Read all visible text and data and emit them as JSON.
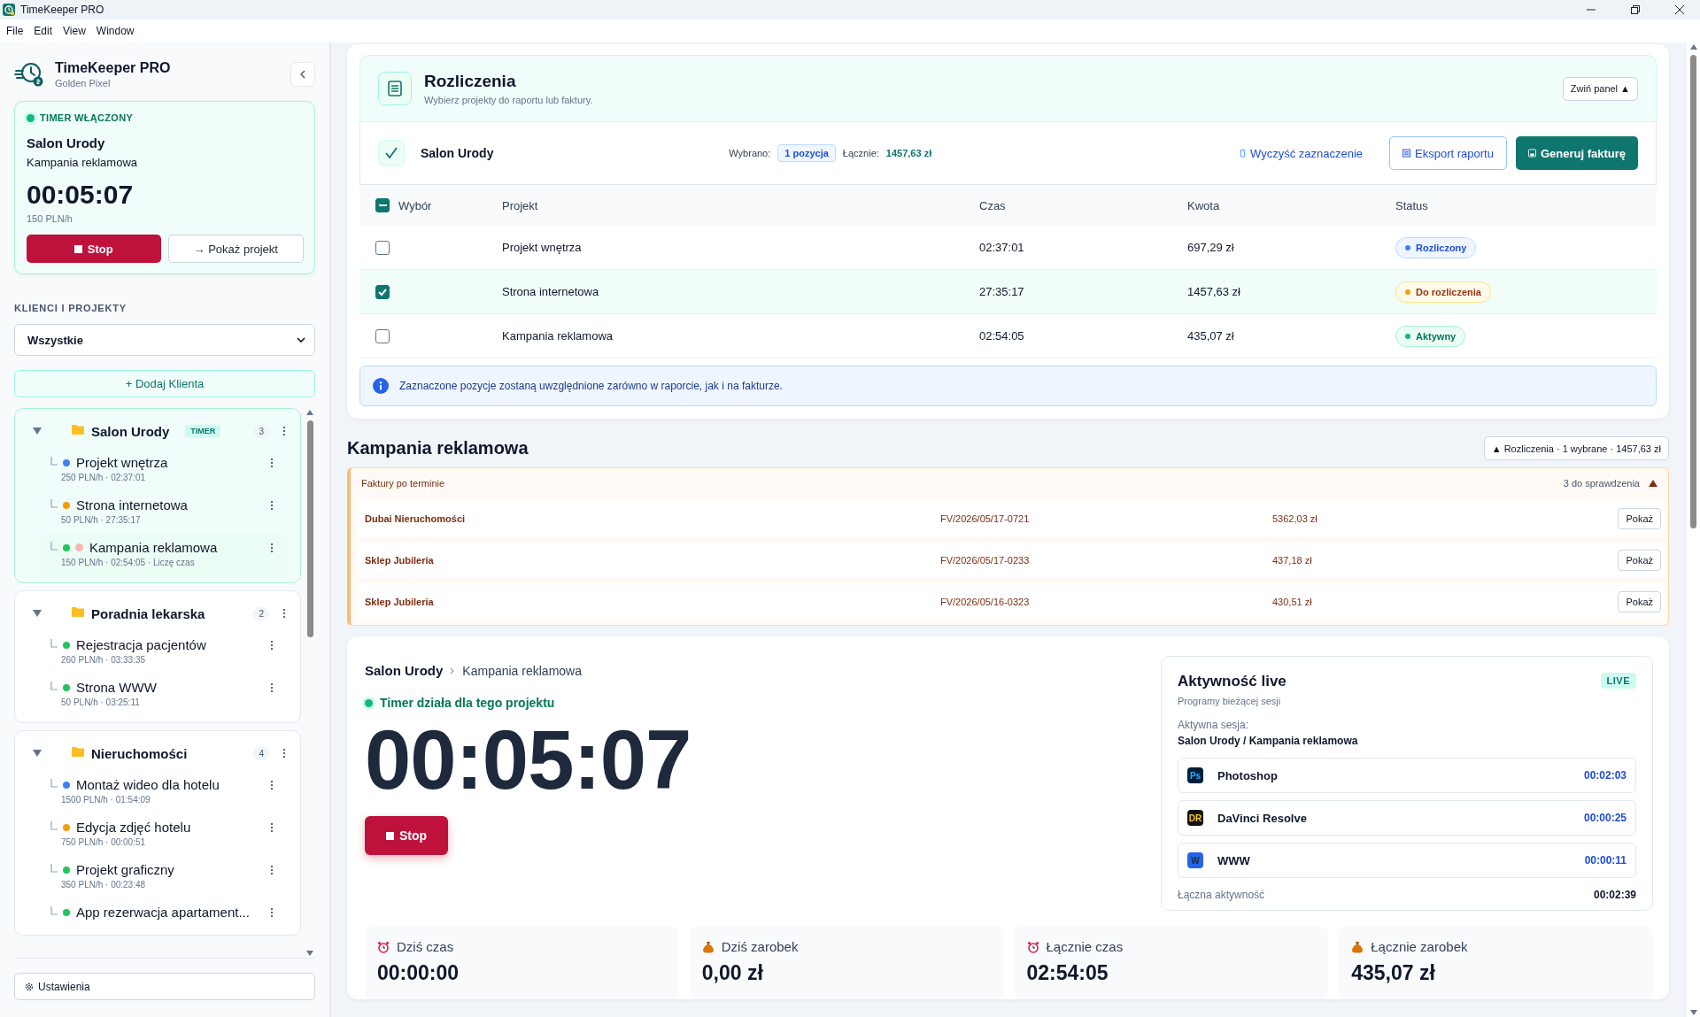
{
  "window": {
    "title": "TimeKeeper PRO"
  },
  "menu": [
    "File",
    "Edit",
    "View",
    "Window"
  ],
  "sidebar": {
    "app_name": "TimeKeeper PRO",
    "subtitle": "Golden Pixel",
    "timer_card": {
      "status": "TIMER WŁĄCZONY",
      "running": true,
      "client": "Salon Urody",
      "project": "Kampania reklamowa",
      "time": "00:05:07",
      "rate": "150 PLN/h",
      "stop": "Stop",
      "show": "→ Pokaż projekt"
    },
    "section_title": "KLIENCI I PROJEKTY",
    "filter": {
      "value": "Wszystkie"
    },
    "add_button": "+ Dodaj Klienta",
    "clients": [
      {
        "name": "Salon Urody",
        "badge": "TIMER",
        "count": "3",
        "expanded": true,
        "projects": [
          {
            "name": "Projekt wnętrza",
            "color": "#3b82f6",
            "meta": "250 PLN/h · 02:37:01",
            "running": false
          },
          {
            "name": "Strona internetowa",
            "color": "#f59e0b",
            "meta": "50 PLN/h · 27:35:17",
            "running": false
          },
          {
            "name": "Kampania reklamowa",
            "color": "#22c55e",
            "meta": "150 PLN/h · 02:54:05 · Liczę czas",
            "running": true
          }
        ]
      },
      {
        "name": "Poradnia lekarska",
        "count": "2",
        "expanded": true,
        "projects": [
          {
            "name": "Rejestracja pacjentów",
            "color": "#22c55e",
            "meta": "260 PLN/h · 03:33:35",
            "running": false
          },
          {
            "name": "Strona WWW",
            "color": "#22c55e",
            "meta": "50 PLN/h · 03:25:11",
            "running": false
          }
        ]
      },
      {
        "name": "Nieruchomości",
        "count": "4",
        "expanded": true,
        "projects": [
          {
            "name": "Montaż wideo dla hotelu",
            "color": "#3b82f6",
            "meta": "1500 PLN/h · 01:54:09",
            "running": false
          },
          {
            "name": "Edycja zdjęć hotelu",
            "color": "#f59e0b",
            "meta": "750 PLN/h · 00:00:51",
            "running": false
          },
          {
            "name": "Projekt graficzny",
            "color": "#22c55e",
            "meta": "350 PLN/h · 00:23:48",
            "running": false
          },
          {
            "name": "App rezerwacja apartament...",
            "color": "#22c55e",
            "running": false
          }
        ]
      }
    ],
    "settings": "Ustawienia"
  },
  "billing": {
    "title": "Rozliczenia",
    "subtitle": "Wybierz projekty do raportu lub faktury.",
    "collapse_button": "Zwiń panel ▲",
    "client": "Salon Urody",
    "selected_label": "Wybrano:",
    "selected_count": "1 pozycja",
    "total_label": "Łącznie:",
    "total": "1457,63 zł",
    "clear": "Wyczyść zaznaczenie",
    "export": "Eksport raportu",
    "invoice": "Generuj fakturę",
    "header_checkbox": {
      "mixed": true
    },
    "columns": [
      "Wybór",
      "Projekt",
      "Czas",
      "Kwota",
      "Status"
    ],
    "rows": [
      {
        "project": "Projekt wnętrza",
        "time": "02:37:01",
        "amount": "697,29 zł",
        "status": "Rozliczony",
        "kind": "settled",
        "selected": false
      },
      {
        "project": "Strona internetowa",
        "time": "27:35:17",
        "amount": "1457,63 zł",
        "status": "Do rozliczenia",
        "kind": "due",
        "selected": true
      },
      {
        "project": "Kampania reklamowa",
        "time": "02:54:05",
        "amount": "435,07 zł",
        "status": "Aktywny",
        "kind": "active",
        "selected": false
      }
    ],
    "info": "Zaznaczone pozycje zostaną uwzględnione zarówno w raporcie, jak i na fakturze."
  },
  "project_heading": "Kampania reklamowa",
  "billing_toggle": "▲ Rozliczenia · 1 wybrane · 1457,63 zł",
  "overdue": {
    "title": "Faktury po terminie",
    "count": "3 do sprawdzenia",
    "expanded": true,
    "items": [
      {
        "client": "Dubai Nieruchomości",
        "number": "FV/2026/05/17-0721",
        "amount": "5362,03 zł",
        "button": "Pokaż"
      },
      {
        "client": "Sklep Jubileria",
        "number": "FV/2026/05/17-0233",
        "amount": "437,18 zł",
        "button": "Pokaż"
      },
      {
        "client": "Sklep Jubileria",
        "number": "FV/2026/05/16-0323",
        "amount": "430,51 zł",
        "button": "Pokaż"
      }
    ]
  },
  "project_view": {
    "breadcrumb": [
      "Salon Urody",
      "Kampania reklamowa"
    ],
    "status": "Timer działa dla tego projektu",
    "running": true,
    "time": "00:05:07",
    "stop": "Stop"
  },
  "activity": {
    "title": "Aktywność live",
    "subtitle": "Programy bieżącej sesji",
    "badge": "LIVE",
    "session_label": "Aktywna sesja:",
    "session": "Salon Urody / Kampania reklamowa",
    "apps": [
      {
        "icon_text": "Ps",
        "name": "Photoshop",
        "time": "00:02:03",
        "color": "#001e36"
      },
      {
        "icon_text": "DR",
        "name": "DaVinci Resolve",
        "time": "00:00:25",
        "color": "#111111"
      },
      {
        "icon_text": "W",
        "name": "WWW",
        "time": "00:00:11",
        "color": "#2563eb"
      }
    ],
    "total_label": "Łączna aktywność",
    "total": "00:02:39"
  },
  "stats": [
    {
      "kind": "time",
      "label": "Dziś czas",
      "value": "00:00:00"
    },
    {
      "kind": "money",
      "label": "Dziś zarobek",
      "value": "0,00 zł"
    },
    {
      "kind": "time",
      "label": "Łącznie czas",
      "value": "02:54:05"
    },
    {
      "kind": "money",
      "label": "Łącznie zarobek",
      "value": "435,07 zł"
    }
  ]
}
